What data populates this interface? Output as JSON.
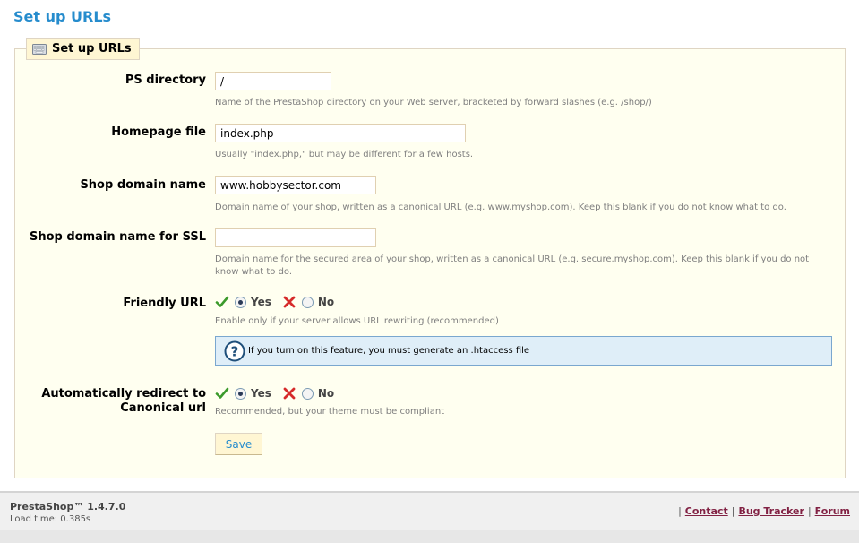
{
  "page_title": "Set up URLs",
  "fieldset": {
    "legend": "Set up URLs",
    "legend_icon": "keyboard-icon"
  },
  "fields": {
    "ps_directory": {
      "label": "PS directory",
      "value": "/",
      "hint": "Name of the PrestaShop directory on your Web server, bracketed by forward slashes (e.g. /shop/)"
    },
    "homepage_file": {
      "label": "Homepage file",
      "value": "index.php",
      "hint": "Usually \"index.php,\" but may be different for a few hosts."
    },
    "shop_domain": {
      "label": "Shop domain name",
      "value": "www.hobbysector.com",
      "hint": "Domain name of your shop, written as a canonical URL (e.g. www.myshop.com). Keep this blank if you do not know what to do."
    },
    "shop_domain_ssl": {
      "label": "Shop domain name for SSL",
      "value": "",
      "hint": "Domain name for the secured area of your shop, written as a canonical URL (e.g. secure.myshop.com). Keep this blank if you do not know what to do."
    },
    "friendly_url": {
      "label": "Friendly URL",
      "yes_label": "Yes",
      "no_label": "No",
      "selected": "Yes",
      "hint": "Enable only if your server allows URL rewriting (recommended)",
      "info_text": "If you turn on this feature, you must",
      "info_link": "generate an .htaccess file"
    },
    "canonical_redirect": {
      "label": "Automatically redirect to Canonical url",
      "yes_label": "Yes",
      "no_label": "No",
      "selected": "Yes",
      "hint": "Recommended, but your theme must be compliant"
    }
  },
  "save_label": "Save",
  "footer": {
    "version": "PrestaShop™ 1.4.7.0",
    "load_time": "Load time: 0.385s",
    "separator": "|",
    "links": [
      "Contact",
      "Bug Tracker",
      "Forum"
    ]
  },
  "colors": {
    "accent": "#268ccd",
    "fieldset_bg": "#fffff0",
    "info_bg": "#dfeef8",
    "footer_link": "#812143"
  }
}
